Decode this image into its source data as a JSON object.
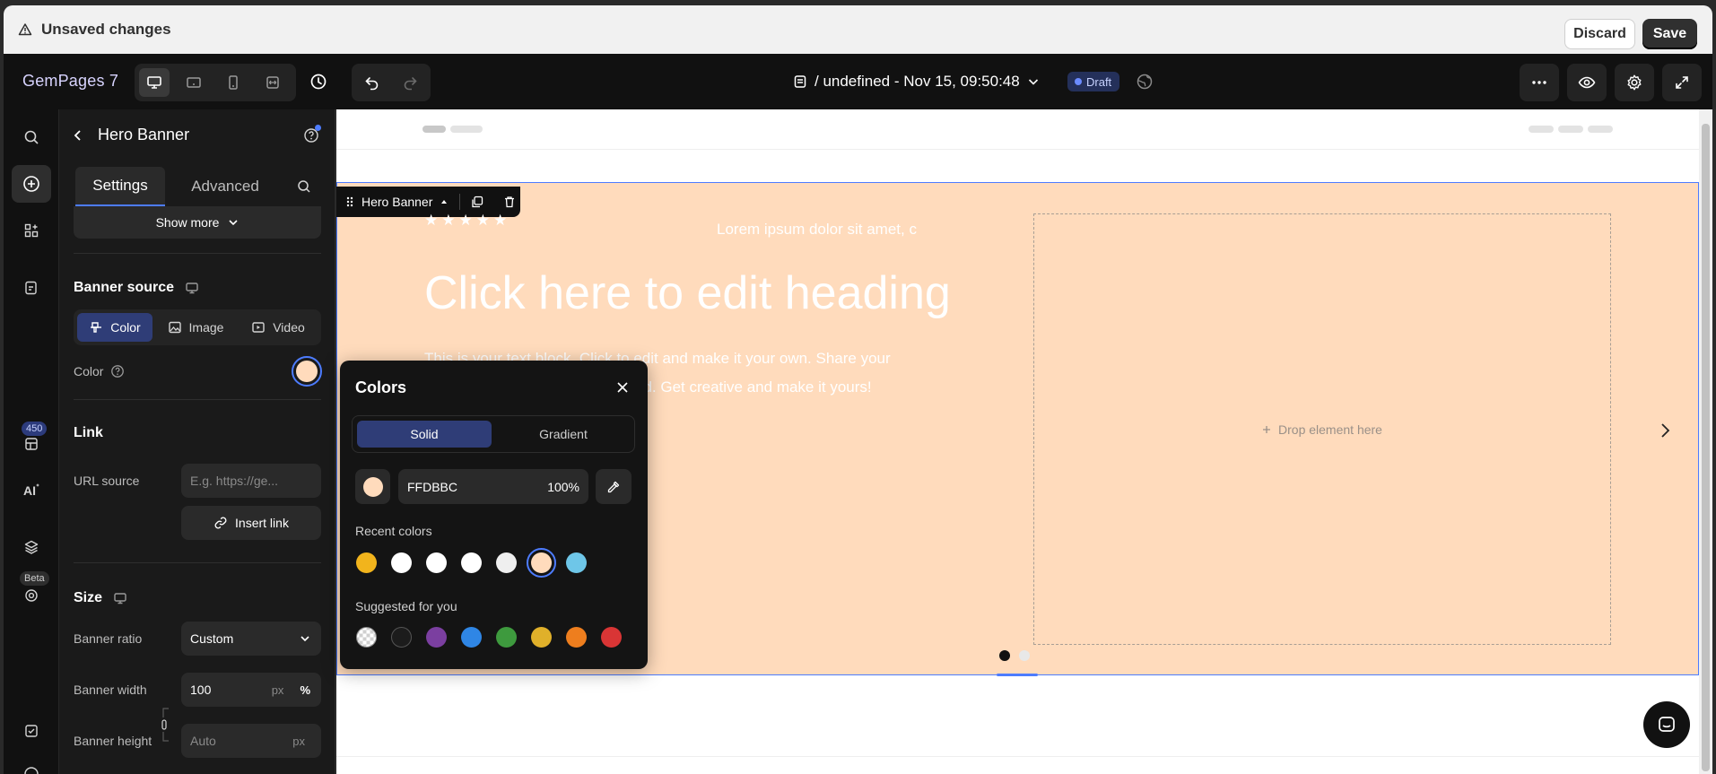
{
  "topbar": {
    "title": "Unsaved changes",
    "discard": "Discard",
    "save": "Save"
  },
  "app": {
    "logo": "GemPages 7",
    "page_title": "/ undefined - Nov 15, 09:50:48",
    "status": "Draft"
  },
  "rail": {
    "badge_count": "450",
    "beta": "Beta"
  },
  "panel": {
    "title": "Hero Banner",
    "tabs": [
      "Settings",
      "Advanced"
    ],
    "show_more": "Show more",
    "banner_source": {
      "heading": "Banner source",
      "options": [
        "Color",
        "Image",
        "Video"
      ],
      "selected": "Color",
      "color_label": "Color"
    },
    "link": {
      "heading": "Link",
      "url_label": "URL source",
      "url_placeholder": "E.g. https://ge...",
      "insert": "Insert link"
    },
    "size": {
      "heading": "Size",
      "ratio_label": "Banner ratio",
      "ratio_value": "Custom",
      "width_label": "Banner width",
      "width_value": "100",
      "height_label": "Banner height",
      "height_placeholder": "Auto",
      "unit_px": "px",
      "unit_pct": "%"
    }
  },
  "canvas": {
    "hero_tag": "Hero Banner",
    "stars": "★★★★★",
    "lorem": "Lorem ipsum dolor sit amet, c",
    "heading": "Click here to edit heading",
    "body_line1": "This is your text block. Click to edit and make it your own. Share your",
    "body_line2": "ed. Get creative and make it yours!",
    "drop": "Drop element here",
    "background_color": "#FFDBBC"
  },
  "colors_popover": {
    "title": "Colors",
    "tabs": [
      "Solid",
      "Gradient"
    ],
    "hex": "FFDBBC",
    "opacity": "100%",
    "recent_label": "Recent colors",
    "recent": [
      "#F2B41C",
      "#FFFFFF",
      "#FFFFFF",
      "#FFFFFF",
      "#EFEFEF",
      "#FFDBBC",
      "#6EC6E8"
    ],
    "suggested_label": "Suggested for you",
    "suggested": [
      "transparent",
      "#1C1C1C",
      "#7B3FA0",
      "#2F86E5",
      "#3E9A3E",
      "#E0B02A",
      "#EE7E1E",
      "#D93535"
    ]
  },
  "icons": {
    "warning": "warning-icon",
    "desktop": "desktop-icon",
    "tablet": "tablet-icon",
    "mobile": "mobile-icon",
    "history": "history-icon",
    "undo": "undo-icon",
    "redo": "redo-icon",
    "more": "more-icon",
    "preview": "eye-icon",
    "settings": "gear-icon",
    "expand": "expand-icon"
  }
}
